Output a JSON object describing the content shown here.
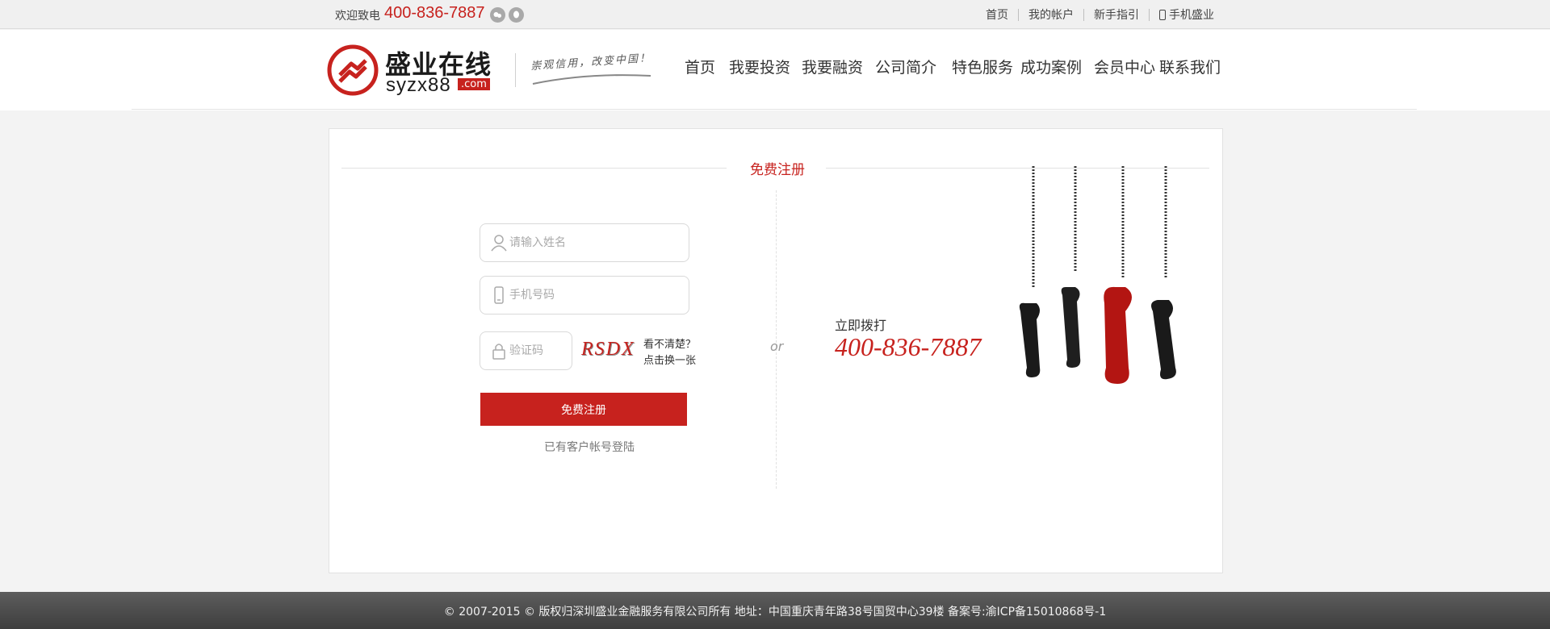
{
  "topbar": {
    "welcome": "欢迎致电",
    "hotline": "400-836-7887",
    "wechat_icon": "wechat-icon",
    "qq_icon": "qq-icon",
    "links": [
      "首页",
      "我的帐户",
      "新手指引",
      "手机盛业"
    ]
  },
  "header": {
    "logo_cn": "盛业在线",
    "logo_en": "syzx88",
    "logo_com": ".com",
    "slogan": "崇观信用，改变中国！"
  },
  "nav": [
    "首页",
    "我要投资",
    "我要融资",
    "公司简介",
    "特色服务",
    "成功案例",
    "会员中心",
    "联系我们"
  ],
  "form": {
    "title": "免费注册",
    "name_placeholder": "请输入姓名",
    "mobile_placeholder": "手机号码",
    "code_placeholder": "验证码",
    "captcha": "RSDX",
    "refresh_line1": "看不清楚？",
    "refresh_line2": "点击换一张",
    "submit": "免费注册",
    "login_link": "已有客户帐号登陆"
  },
  "divider_text": "or",
  "call": {
    "label": "立即拨打",
    "number": "400-836-7887"
  },
  "footer": {
    "text": "© 2007-2015 © 版权归深圳盛业金融服务有限公司所有     地址：中国重庆青年路38号国贸中心39楼     备案号:渝ICP备15010868号-1"
  },
  "colors": {
    "brand_red": "#c7221e",
    "footer_bg": "#4a4a4a",
    "page_bg": "#f3f3f3"
  }
}
